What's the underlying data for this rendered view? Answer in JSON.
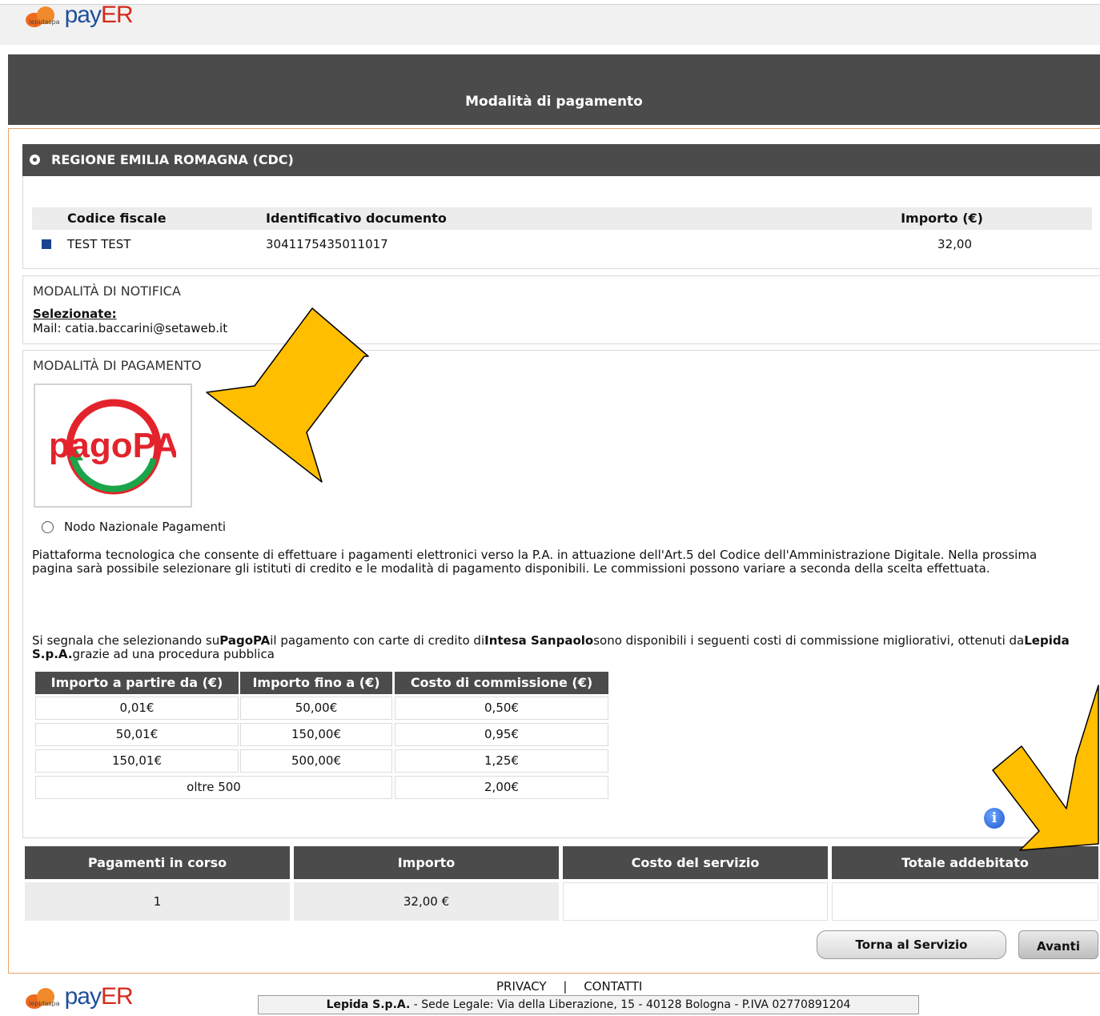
{
  "header": {
    "brand_small": "lepidaspa",
    "brand_pay": "pay",
    "brand_er": "ER"
  },
  "page_title": "Modalità di pagamento",
  "ente": {
    "label": "REGIONE EMILIA ROMAGNA (CDC)"
  },
  "documents": {
    "columns": [
      "Codice fiscale",
      "Identificativo documento",
      "Importo (€)"
    ],
    "rows": [
      {
        "codice_fiscale": "TEST TEST",
        "identificativo": "3041175435011017",
        "importo": "32,00"
      }
    ]
  },
  "notifica": {
    "title": "MODALITÀ DI NOTIFICA",
    "selected_label": "Selezionate:",
    "mail": "Mail: catia.baccarini@setaweb.it"
  },
  "pagamento": {
    "title": "MODALITÀ DI PAGAMENTO",
    "logo_text": "pagoPA",
    "option_label": "Nodo Nazionale Pagamenti",
    "description": "Piattaforma tecnologica che consente di effettuare i pagamenti elettronici verso la P.A. in attuazione dell'Art.5 del Codice dell'Amministrazione Digitale. Nella prossima pagina sarà possibile selezionare gli istituti di credito e le modalità di pagamento disponibili. Le commissioni possono variare a seconda della scelta effettuata.",
    "note": {
      "p1": "Si segnala che selezionando su",
      "b1": "PagoPA",
      "p2": "il pagamento con carte di credito di",
      "b2": "Intesa Sanpaolo",
      "p3": "sono disponibili i seguenti costi di commissione migliorativi, ottenuti da",
      "b3": "Lepida S.p.A.",
      "p4": "grazie ad una procedura pubblica"
    },
    "fees": {
      "columns": [
        "Importo a partire da (€)",
        "Importo fino a (€)",
        "Costo di commissione (€)"
      ],
      "rows": [
        [
          "0,01€",
          "50,00€",
          "0,50€"
        ],
        [
          "50,01€",
          "150,00€",
          "0,95€"
        ],
        [
          "150,01€",
          "500,00€",
          "1,25€"
        ]
      ],
      "last_row": {
        "range": "oltre 500",
        "cost": "2,00€"
      }
    },
    "info_glyph": "i"
  },
  "summary": {
    "columns": [
      "Pagamenti in corso",
      "Importo",
      "Costo del servizio",
      "Totale addebitato"
    ],
    "values": [
      "1",
      "32,00 €",
      "",
      ""
    ]
  },
  "buttons": {
    "back": "Torna al Servizio",
    "next": "Avanti"
  },
  "footer": {
    "privacy": "PRIVACY",
    "separator": "|",
    "contatti": "CONTATTI",
    "legal_bold": "Lepida S.p.A.",
    "legal_rest": " - Sede Legale: Via della Liberazione, 15 - 40128 Bologna - P.IVA 02770891204"
  },
  "colors": {
    "dark_bar": "#4b4b4b",
    "frame": "#e8a36a",
    "arrow": "#ffbe00",
    "brand_blue": "#1e4f9c",
    "brand_red": "#d42a1b"
  }
}
